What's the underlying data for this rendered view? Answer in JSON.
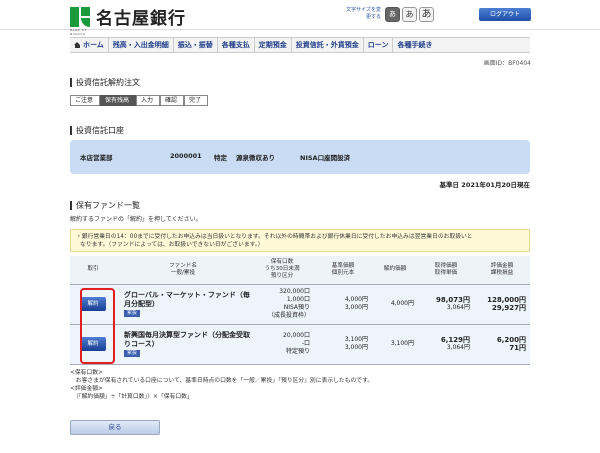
{
  "header": {
    "bank_name": "名古屋銀行",
    "logo_sub": "BANK OF NAGOYA",
    "fontsize_label": "文字サイズを変更する",
    "font_buttons": [
      "あ",
      "あ",
      "あ"
    ],
    "logout": "ログアウト"
  },
  "nav": {
    "items": [
      "ホーム",
      "残高・入出金明細",
      "振込・振替",
      "各種支払",
      "定期預金",
      "投資信託・外貨預金",
      "ローン",
      "各種手続き"
    ]
  },
  "screen_id": "画面ID：BF0404",
  "page_title": "投資信託解約注文",
  "steps": [
    "ご注意",
    "保有残高",
    "入力",
    "確認",
    "完了"
  ],
  "account_section": {
    "title": "投資信託口座",
    "branch": "本店営業部",
    "account_no": "2000001",
    "account_type": "特定",
    "withholding": "源泉徴収あり",
    "nisa": "NISA口座開設済"
  },
  "base_date": "基準日 2021年01月20日現在",
  "funds_section": {
    "title": "保有ファンド一覧",
    "description": "解約するファンドの「解約」を押してください。",
    "notice_line1": "・銀行営業日の14：00までに受付したお申込みは当日扱いとなります。それ以外の時間帯および銀行休業日に受付したお申込みは翌営業日のお取扱いと",
    "notice_line2": "なります。（ファンドによっては、お取扱いできない日がございます。）"
  },
  "table": {
    "headers": {
      "action": "取引",
      "fund": "ファンド名\n一般/累投",
      "units": "保有口数\nうち30日未満\n預り区分",
      "base_price": "基準価額\n個別元本",
      "cancel_price": "解約価額",
      "acq_amount": "取得価額\n取得単価",
      "valuation": "評価金額\n課税損益"
    },
    "rows": [
      {
        "button": "解約",
        "name": "グローバル・マーケット・ファンド（毎月分配型）",
        "type": "累投",
        "units": "320,000口",
        "units_30": "1,000口",
        "category": "NISA預り",
        "category2": "（成長投資枠）",
        "base_price": "4,000円",
        "principal": "3,000円",
        "cancel_price": "4,000円",
        "acq_amount": "98,073円",
        "acq_unit": "3,064円",
        "valuation": "128,000円",
        "pnl": "29,927円"
      },
      {
        "button": "解約",
        "name": "新興国毎月決算型ファンド（分配金受取りコース）",
        "type": "累投",
        "units": "20,000口",
        "units_30": "-口",
        "category": "特定預り",
        "category2": "",
        "base_price": "3,100円",
        "principal": "3,000円",
        "cancel_price": "3,100円",
        "acq_amount": "6,129円",
        "acq_unit": "3,064円",
        "valuation": "6,200円",
        "pnl": "71円"
      }
    ]
  },
  "notes": {
    "line1": "<保有口数>",
    "line2": "　お客さまが保有されている口座について、基準日時点の口数を「一般／累投」「預り区分」別に表示したものです。",
    "line3": "<評価金額>",
    "line4": "　（「解約価額」÷「計算口数」）×「保有口数」"
  },
  "back_button": "戻る"
}
